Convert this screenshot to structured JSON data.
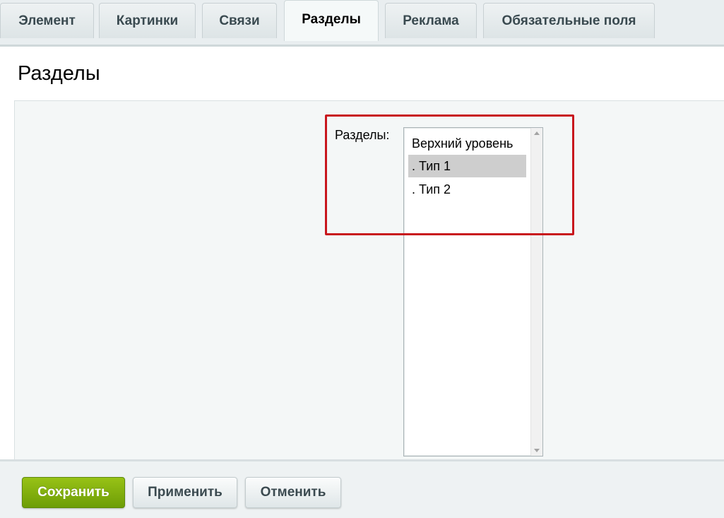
{
  "tabs": [
    {
      "label": "Элемент"
    },
    {
      "label": "Картинки"
    },
    {
      "label": "Связи"
    },
    {
      "label": "Разделы",
      "active": true
    },
    {
      "label": "Реклама"
    },
    {
      "label": "Обязательные поля"
    }
  ],
  "panel": {
    "title": "Разделы",
    "field_label": "Разделы:",
    "options": [
      {
        "label": "Верхний уровень",
        "selected": false
      },
      {
        "label": ". Тип 1",
        "selected": true
      },
      {
        "label": ". Тип 2",
        "selected": false
      }
    ]
  },
  "footer": {
    "save_label": "Сохранить",
    "apply_label": "Применить",
    "cancel_label": "Отменить"
  },
  "colors": {
    "highlight_border": "#c8161d",
    "primary_button": "#7aab0c",
    "selected_option": "#cecece"
  }
}
